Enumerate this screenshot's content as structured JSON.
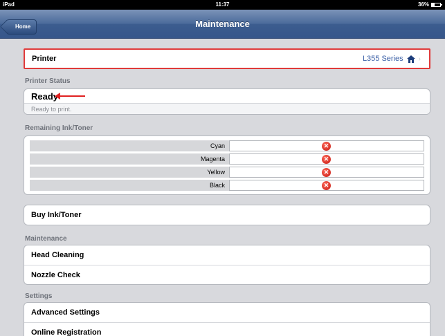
{
  "status_bar": {
    "device": "iPad",
    "time": "11:37",
    "battery": "36%"
  },
  "nav": {
    "back_label": "Home",
    "title": "Maintenance"
  },
  "printer": {
    "label": "Printer",
    "model": "L355 Series"
  },
  "printer_status": {
    "header": "Printer Status",
    "state": "Ready",
    "detail": "Ready to print."
  },
  "ink": {
    "header": "Remaining Ink/Toner",
    "colors": [
      "Cyan",
      "Magenta",
      "Yellow",
      "Black"
    ]
  },
  "buy": {
    "label": "Buy  Ink/Toner"
  },
  "maintenance": {
    "header": "Maintenance",
    "items": [
      "Head Cleaning",
      "Nozzle Check"
    ]
  },
  "settings": {
    "header": "Settings",
    "items": [
      "Advanced Settings",
      "Online Registration"
    ]
  },
  "colors": {
    "nav_blue": "#3c5d8f",
    "highlight_red": "#e03a3a",
    "link_blue": "#3a5fa6",
    "error_red": "#c4160f"
  },
  "icons": {
    "printer_home": "home-icon",
    "ink_error": "error-x-icon",
    "annotation_arrow": "red-arrow"
  }
}
